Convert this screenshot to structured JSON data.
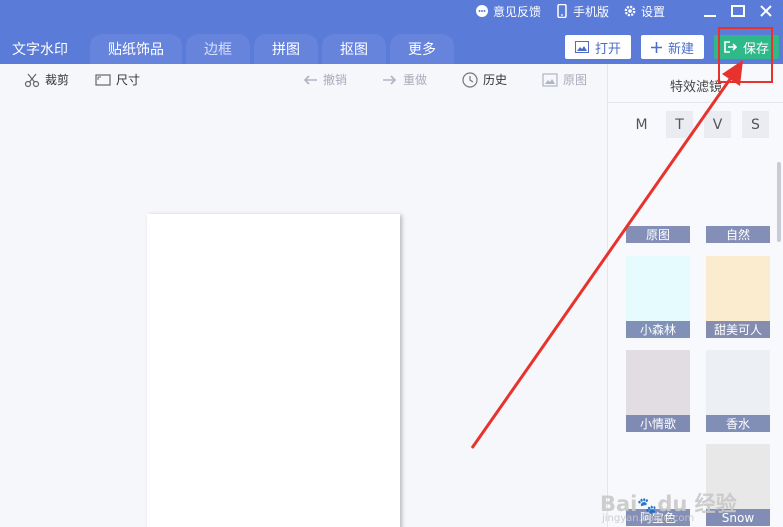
{
  "top_links": [
    {
      "label": "意见反馈",
      "icon": "chat-icon"
    },
    {
      "label": "手机版",
      "icon": "phone-icon"
    },
    {
      "label": "设置",
      "icon": "gear-icon"
    }
  ],
  "window_controls": [
    "minimize-icon",
    "maximize-icon",
    "close-icon"
  ],
  "tabs": [
    {
      "label": "文字水印"
    },
    {
      "label": "贴纸饰品"
    },
    {
      "label": "边框"
    },
    {
      "label": "拼图"
    },
    {
      "label": "抠图"
    },
    {
      "label": "更多"
    }
  ],
  "actions": {
    "open": "打开",
    "new": "新建",
    "save": "保存"
  },
  "toolbar": {
    "crop": "裁剪",
    "size": "尺寸",
    "undo": "撤销",
    "redo": "重做",
    "history": "历史",
    "original": "原图"
  },
  "panel": {
    "title": "特效滤镜",
    "letters": [
      "M",
      "T",
      "V",
      "S"
    ],
    "filters": [
      {
        "label": "原图",
        "color": "#ffffff"
      },
      {
        "label": "自然",
        "color": "#ffffff"
      },
      {
        "label": "小森林",
        "color": "#e6fbfd"
      },
      {
        "label": "甜美可人",
        "color": "#fbecd0"
      },
      {
        "label": "小情歌",
        "color": "#e2dde2"
      },
      {
        "label": "香水",
        "color": "#ecf0f4"
      },
      {
        "label": "阿宝色",
        "color": "#ffffff"
      },
      {
        "label": "Snow",
        "color": "#e8e8e8"
      }
    ]
  },
  "colors": {
    "topbar": "#5a7bd8",
    "save": "#2fb98a",
    "annotation": "#e8322e"
  },
  "watermark": {
    "main": "Bai du 经验",
    "sub": "jingyan.baidu.com"
  }
}
